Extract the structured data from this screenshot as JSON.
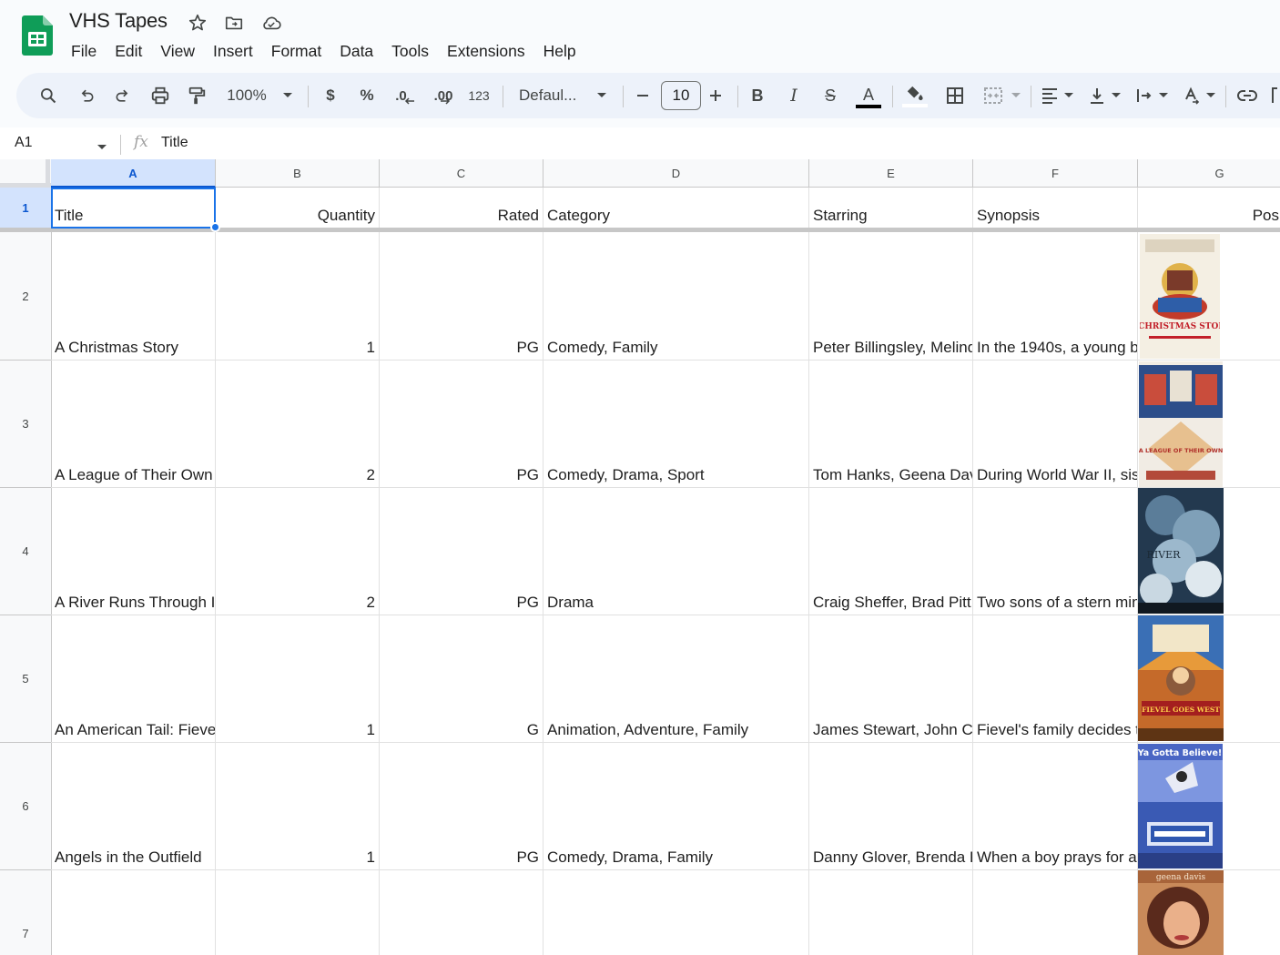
{
  "doc": {
    "title": "VHS Tapes"
  },
  "menu": [
    "File",
    "Edit",
    "View",
    "Insert",
    "Format",
    "Data",
    "Tools",
    "Extensions",
    "Help"
  ],
  "toolbar": {
    "zoom": "100%",
    "currency": "$",
    "percent": "%",
    "decrease_decimal": ".0",
    "increase_decimal": ".00",
    "more_formats": "123",
    "font": "Defaul...",
    "font_size": "10",
    "bold": "B",
    "italic": "I",
    "strikethrough": "S",
    "text_color_letter": "A"
  },
  "formula_bar": {
    "cell_ref": "A1",
    "content": "Title"
  },
  "columns": [
    "A",
    "B",
    "C",
    "D",
    "E",
    "F",
    "G"
  ],
  "rows": [
    "1",
    "2",
    "3",
    "4",
    "5",
    "6",
    "7"
  ],
  "header_row": {
    "title": "Title",
    "quantity": "Quantity",
    "rated": "Rated",
    "category": "Category",
    "starring": "Starring",
    "synopsis": "Synopsis",
    "poster": "Pos"
  },
  "records": [
    {
      "title": "A Christmas Story",
      "quantity": "1",
      "rated": "PG",
      "category": "Comedy, Family",
      "starring": "Peter Billingsley, Melind",
      "synopsis": "In the 1940s, a young b",
      "poster_text": "A CHRISTMAS STORY"
    },
    {
      "title": "A League of Their Own",
      "quantity": "2",
      "rated": "PG",
      "category": "Comedy, Drama, Sport",
      "starring": "Tom Hanks, Geena Dav",
      "synopsis": "During World War II, sis",
      "poster_text": "A LEAGUE OF THEIR OWN"
    },
    {
      "title": "A River Runs Through I",
      "quantity": "2",
      "rated": "PG",
      "category": "Drama",
      "starring": "Craig Sheffer, Brad Pitt,",
      "synopsis": "Two sons of a stern min",
      "poster_text": "RIVER"
    },
    {
      "title": "An American Tail: Fieve",
      "quantity": "1",
      "rated": "G",
      "category": "Animation, Adventure, Family",
      "starring": "James Stewart, John Cl",
      "synopsis": "Fievel's family decides t",
      "poster_text": "FIEVEL GOES WEST"
    },
    {
      "title": "Angels in the Outfield",
      "quantity": "1",
      "rated": "PG",
      "category": "Comedy, Drama, Family",
      "starring": "Danny Glover, Brenda F",
      "synopsis": "When a boy prays for a",
      "poster_text": "Ya Gotta Believe!"
    },
    {
      "title": "",
      "quantity": "",
      "rated": "",
      "category": "",
      "starring": "",
      "synopsis": "",
      "poster_text": "geena davis"
    }
  ],
  "colors": {
    "accent": "#1a73e8",
    "selected_header_bg": "#d3e3fd",
    "sheets_green": "#0f9d58"
  }
}
